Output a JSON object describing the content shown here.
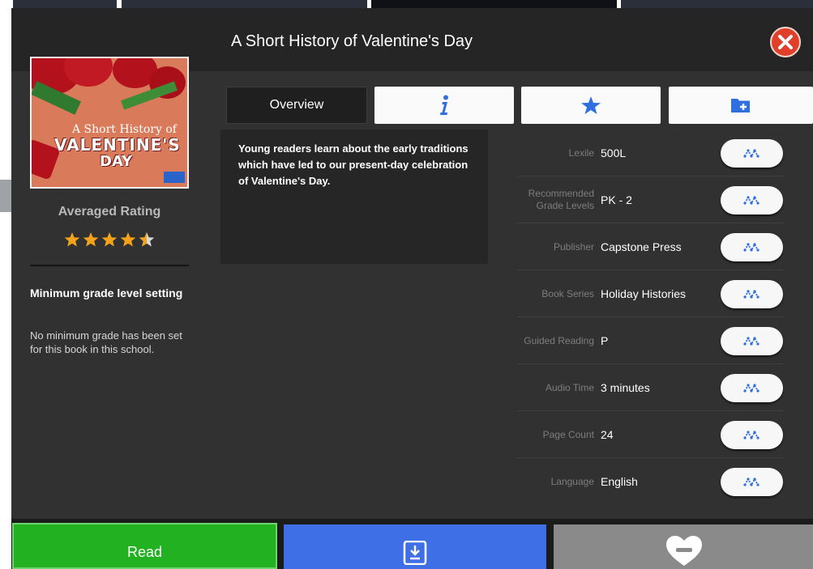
{
  "book": {
    "title": "A Short History of Valentine's Day",
    "cover_line1": "A Short History of",
    "cover_line2": "VALENTINE'S",
    "cover_line3": "DAY"
  },
  "rating": {
    "label": "Averaged Rating",
    "stars": 4.5,
    "max_stars": 5
  },
  "min_grade": {
    "title": "Minimum grade level setting",
    "text": "No minimum grade has been set for this book in this school."
  },
  "tabs": [
    {
      "label": "Overview",
      "icon": "",
      "active": true
    },
    {
      "label": "",
      "icon": "info-icon",
      "active": false
    },
    {
      "label": "",
      "icon": "star-icon",
      "active": false
    },
    {
      "label": "",
      "icon": "folder-add-icon",
      "active": false
    }
  ],
  "description": "Young readers learn about the early traditions which have led to our present-day celebration of Valentine's Day.",
  "metadata": [
    {
      "label": "Lexile",
      "value": "500L",
      "button_icon": "related-search-icon"
    },
    {
      "label": "Recommended Grade Levels",
      "value": "PK - 2",
      "button_icon": "related-search-icon"
    },
    {
      "label": "Publisher",
      "value": "Capstone Press",
      "button_icon": "related-search-icon"
    },
    {
      "label": "Book Series",
      "value": "Holiday Histories",
      "button_icon": "related-search-icon"
    },
    {
      "label": "Guided Reading",
      "value": "P",
      "button_icon": "related-search-icon"
    },
    {
      "label": "Audio Time",
      "value": "3 minutes",
      "button_icon": "related-search-icon"
    },
    {
      "label": "Page Count",
      "value": "24",
      "button_icon": "related-search-icon"
    },
    {
      "label": "Language",
      "value": "English",
      "button_icon": "related-search-icon"
    }
  ],
  "actions": {
    "read_label": "Read",
    "download_icon": "download-icon",
    "favorite_icon": "remove-favorite-icon"
  },
  "colors": {
    "read": "#21b121",
    "download": "#3f6fe6",
    "favorite": "#8a8a8a",
    "close": "#e0402a",
    "star": "#f3a21b",
    "icon_blue": "#2f6fe0"
  }
}
